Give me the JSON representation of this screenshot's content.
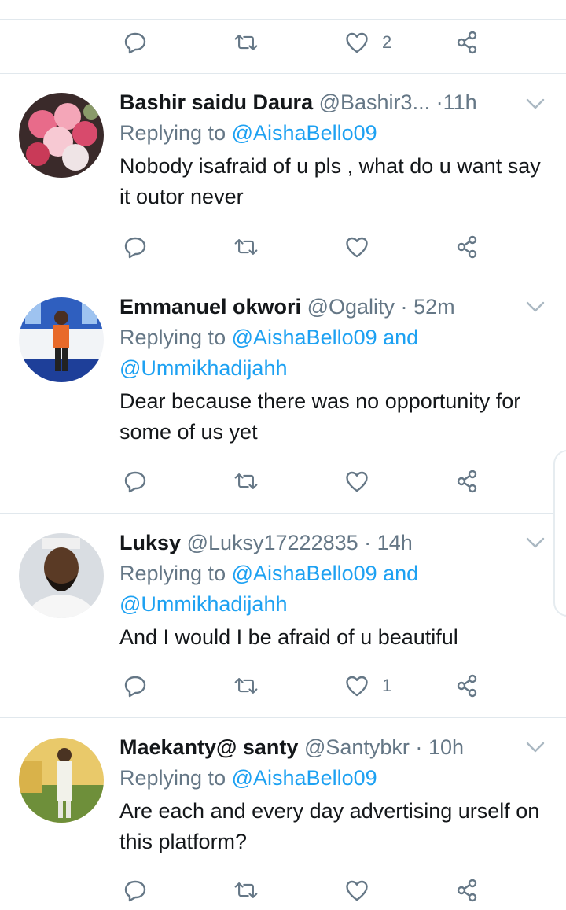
{
  "top_actions": {
    "like_count": "2"
  },
  "tweets": [
    {
      "name": "Bashir  saidu Daura",
      "handle": "@Bashir3...",
      "sep": "·",
      "time": "11h",
      "replying_prefix": "Replying to",
      "mentions": "@AishaBello09",
      "mentions2": "",
      "text": "Nobody isafraid of u pls , what do u want say it outor never",
      "like_count": ""
    },
    {
      "name": "Emmanuel okwori",
      "handle": "@Ogality",
      "sep": "·",
      "time": "52m",
      "replying_prefix": "Replying to",
      "mentions": "@AishaBello09 and",
      "mentions2": "@Ummikhadijahh",
      "text": "Dear because there was no opportunity for some of us yet",
      "like_count": ""
    },
    {
      "name": "Luksy",
      "handle": "@Luksy17222835",
      "sep": "·",
      "time": "14h",
      "replying_prefix": "Replying to",
      "mentions": "@AishaBello09 and",
      "mentions2": "@Ummikhadijahh",
      "text": "And I would I be afraid of u beautiful",
      "like_count": "1"
    },
    {
      "name": "Maekanty@ santy",
      "handle": "@Santybkr",
      "sep": "·",
      "time": "10h",
      "replying_prefix": "Replying to",
      "mentions": "@AishaBello09",
      "mentions2": "",
      "text": "Are each and every day advertising urself on this platform?",
      "like_count": ""
    }
  ],
  "colors": {
    "link": "#1da1f2",
    "muted": "#657786",
    "divider": "#e1e8ed",
    "text": "#14171a"
  },
  "icons": [
    "reply-icon",
    "retweet-icon",
    "like-icon",
    "share-icon",
    "chevron-down-icon"
  ]
}
